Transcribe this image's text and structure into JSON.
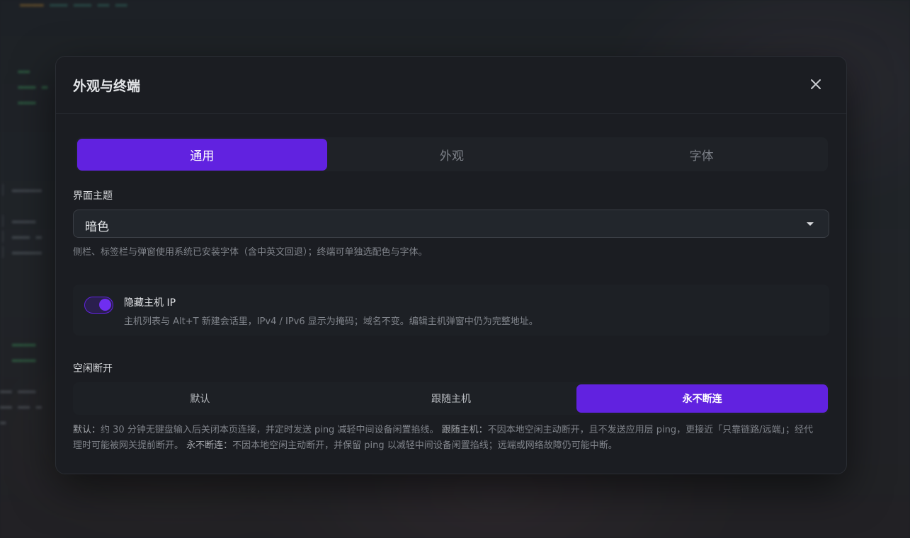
{
  "dialog": {
    "title": "外观与终端"
  },
  "tabs": [
    {
      "label": "通用",
      "active": true
    },
    {
      "label": "外观",
      "active": false
    },
    {
      "label": "字体",
      "active": false
    }
  ],
  "theme": {
    "label": "界面主题",
    "value": "暗色",
    "hint": "侧栏、标签栏与弹窗使用系统已安装字体（含中英文回退）；终端可单独选配色与字体。"
  },
  "hide_ip": {
    "enabled": true,
    "title": "隐藏主机 IP",
    "description": "主机列表与 Alt+T 新建会话里，IPv4 / IPv6 显示为掩码；域名不变。编辑主机弹窗中仍为完整地址。"
  },
  "idle": {
    "label": "空闲断开",
    "options": [
      {
        "label": "默认",
        "active": false
      },
      {
        "label": "跟随主机",
        "active": false
      },
      {
        "label": "永不断连",
        "active": true
      }
    ],
    "desc": {
      "default_key": "默认：",
      "default_text": "约 30 分钟无键盘输入后关闭本页连接，并定时发送 ping 减轻中间设备闲置掐线。",
      "follow_key": "跟随主机：",
      "follow_text": "不因本地空闲主动断开，且不发送应用层 ping，更接近「只靠链路/远端」；经代理时可能被网关提前断开。",
      "never_key": "永不断连：",
      "never_text": "不因本地空闲主动断开，并保留 ping 以减轻中间设备闲置掐线；远端或网络故障仍可能中断。"
    }
  },
  "colors": {
    "accent": "#6122e0",
    "dialog_bg": "#1b1d22"
  },
  "icons": {
    "close": "close-icon"
  }
}
